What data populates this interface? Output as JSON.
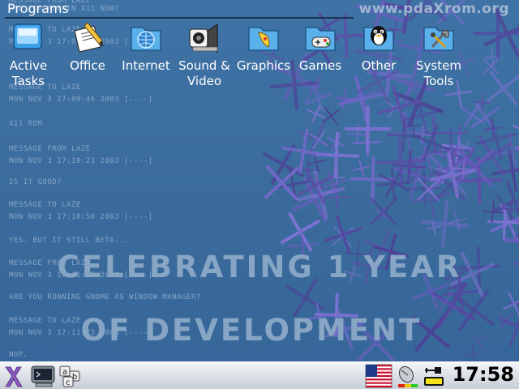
{
  "site_url": "www.pdaXrom.org",
  "menu": {
    "title": "Programs",
    "items": [
      {
        "label": "Active\nTasks",
        "icon": "active-tasks-icon"
      },
      {
        "label": "Office",
        "icon": "office-icon"
      },
      {
        "label": "Internet",
        "icon": "internet-icon"
      },
      {
        "label": "Sound &\nVideo",
        "icon": "sound-video-icon"
      },
      {
        "label": "Graphics",
        "icon": "graphics-icon"
      },
      {
        "label": "Games",
        "icon": "games-icon"
      },
      {
        "label": "Other",
        "icon": "tux-icon"
      },
      {
        "label": "System\nTools",
        "icon": "system-tools-icon"
      }
    ]
  },
  "chat_log": [
    "Message from laze",
    "Are you runnin X11 now?",
    "Message to laze",
    "Mon Nov 3 17:09:03 2003 [----]",
    "Message to laze",
    "Mon Nov 3 17:09:46 2003 [----]",
    "X11 rom",
    "Message from laze",
    "Mon Nov 3 17:10:23 2003 [----]",
    "is it good?",
    "Message to laze",
    "Mon Nov 3 17:10:50 2003 [----]",
    "yes. but it still beta...",
    "Message from laze",
    "Mon Nov 3 17:11:05 2003 [----]",
    "are you running gnome as window manager?",
    "Message to laze",
    "Mon Nov 3 17:11:23 2003 [----]",
    "nop,"
  ],
  "watermark": {
    "line1": "CELEBRATING 1 YEAR",
    "line2": "OF DEVELOPMENT"
  },
  "taskbar": {
    "start_icon": "pdaxrom-x-icon",
    "launchers": [
      "terminal-icon",
      "keyboard-icon"
    ],
    "tray": [
      "us-flag-icon",
      "mouse-icon",
      "battery-icon"
    ],
    "clock": "17:58"
  },
  "colors": {
    "desktop_bg": "#3a6c9c",
    "accent_purple": "#6c5cc0",
    "taskbar_bg": "#dfe3e9"
  }
}
